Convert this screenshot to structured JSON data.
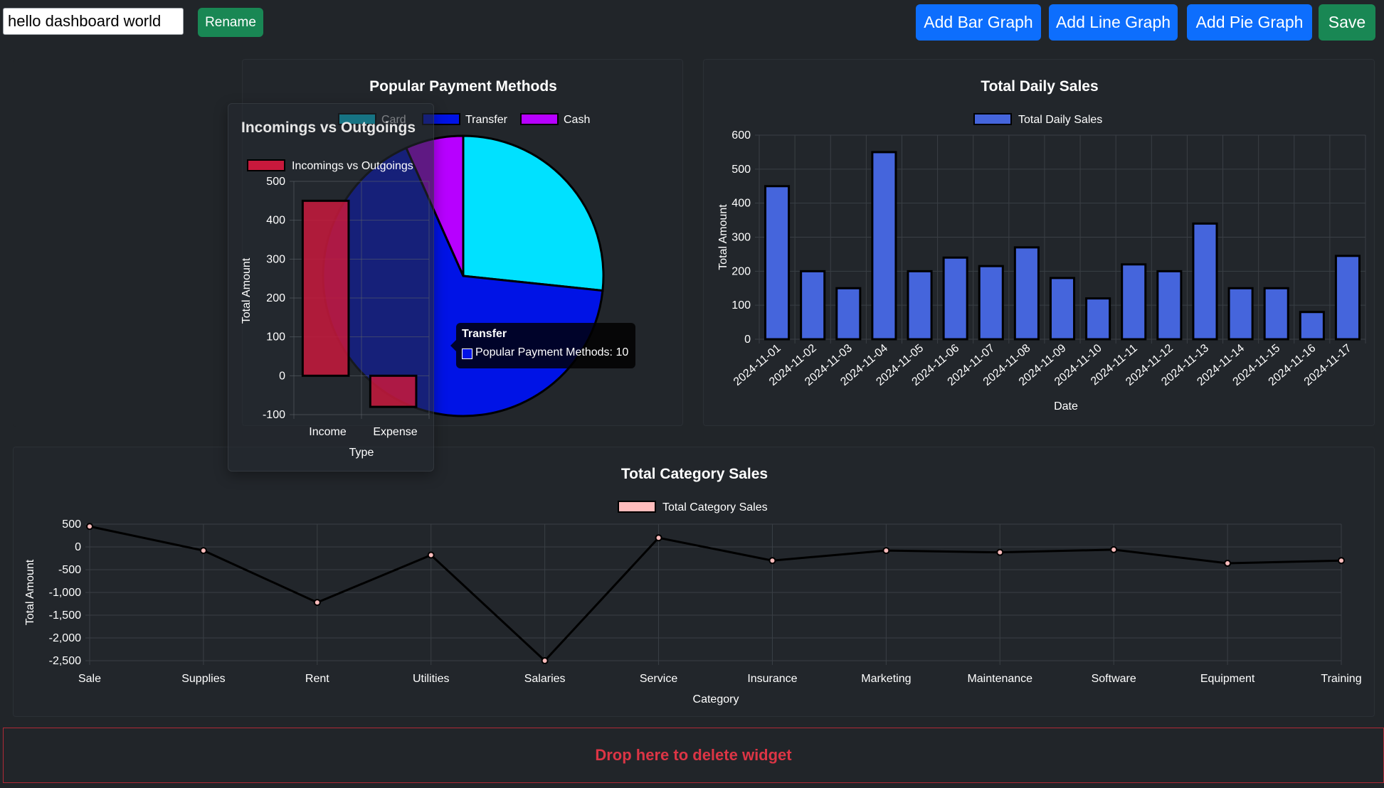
{
  "toolbar": {
    "dashboard_name": "hello dashboard world",
    "rename_label": "Rename",
    "add_bar_label": "Add Bar Graph",
    "add_line_label": "Add Line Graph",
    "add_pie_label": "Add Pie Graph",
    "save_label": "Save"
  },
  "dropzone": {
    "label": "Drop here to delete widget"
  },
  "colors": {
    "background": "#212529",
    "primary": "#0d6efd",
    "success": "#198754",
    "danger": "#dc3545"
  },
  "tooltip": {
    "title": "Transfer",
    "series": "Popular Payment Methods",
    "value": "10",
    "swatch": "#0013e6"
  },
  "chart_data": [
    {
      "id": "payment",
      "type": "pie",
      "title": "Popular Payment Methods",
      "legend_position": "top",
      "series_name": "Popular Payment Methods",
      "labels": [
        "Card",
        "Transfer",
        "Cash"
      ],
      "values": [
        4,
        10,
        1
      ],
      "colors": [
        "#00e1ff",
        "#0013e6",
        "#b700ff"
      ]
    },
    {
      "id": "daily",
      "type": "bar",
      "title": "Total Daily Sales",
      "legend_position": "top",
      "series_name": "Total Daily Sales",
      "xlabel": "Date",
      "ylabel": "Total Amount",
      "ylim": [
        0,
        600
      ],
      "yticks": [
        0,
        100,
        200,
        300,
        400,
        500,
        600
      ],
      "color": "#4565dc",
      "grid": true,
      "categories": [
        "2024-11-01",
        "2024-11-02",
        "2024-11-03",
        "2024-11-04",
        "2024-11-05",
        "2024-11-06",
        "2024-11-07",
        "2024-11-08",
        "2024-11-09",
        "2024-11-10",
        "2024-11-11",
        "2024-11-12",
        "2024-11-13",
        "2024-11-14",
        "2024-11-15",
        "2024-11-16",
        "2024-11-17"
      ],
      "values": [
        450,
        200,
        150,
        550,
        200,
        240,
        215,
        270,
        180,
        120,
        220,
        200,
        340,
        150,
        150,
        80,
        245
      ]
    },
    {
      "id": "category",
      "type": "line",
      "title": "Total Category Sales",
      "legend_position": "top",
      "series_name": "Total Category Sales",
      "xlabel": "Category",
      "ylabel": "Total Amount",
      "ylim": [
        -2500,
        500
      ],
      "yticks": [
        500,
        0,
        -500,
        -1000,
        -1500,
        -2000,
        -2500
      ],
      "ytick_labels": [
        "500",
        "0",
        "-500",
        "-1,000",
        "-1,500",
        "-2,000",
        "-2,500"
      ],
      "color": "#ffbcbc",
      "grid": true,
      "categories": [
        "Sale",
        "Supplies",
        "Rent",
        "Utilities",
        "Salaries",
        "Service",
        "Insurance",
        "Marketing",
        "Maintenance",
        "Software",
        "Equipment",
        "Training"
      ],
      "values": [
        450,
        -80,
        -1220,
        -180,
        -2500,
        200,
        -300,
        -80,
        -120,
        -60,
        -360,
        -300
      ]
    },
    {
      "id": "incomings",
      "type": "bar",
      "title": "Incomings vs Outgoings",
      "legend_position": "top",
      "series_name": "Incomings vs Outgoings",
      "xlabel": "Type",
      "ylabel": "Total Amount",
      "ylim": [
        -100,
        500
      ],
      "yticks": [
        -100,
        0,
        100,
        200,
        300,
        400,
        500
      ],
      "color": "#c8193c",
      "grid": true,
      "categories": [
        "Income",
        "Expense"
      ],
      "values": [
        450,
        -80
      ]
    }
  ]
}
